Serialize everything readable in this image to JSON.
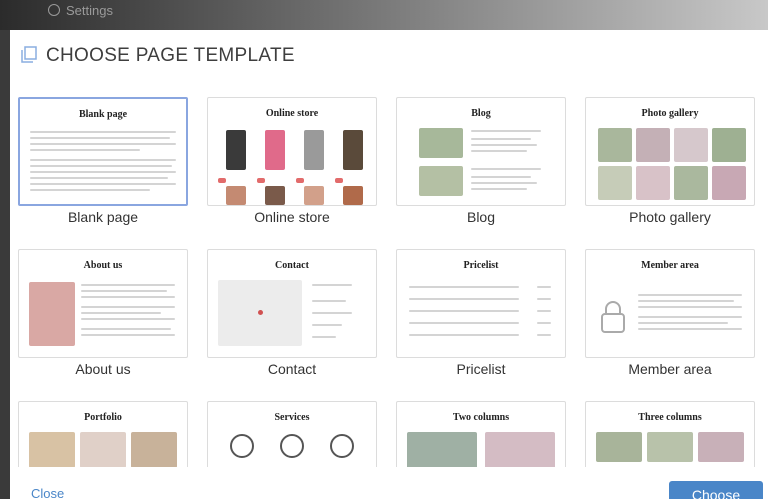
{
  "behind": {
    "label": "Settings",
    "icon": "gear-icon"
  },
  "modal": {
    "title": "CHOOSE PAGE TEMPLATE",
    "title_icon": "pages-icon"
  },
  "templates": [
    {
      "label": "Blank page",
      "thumb_title": "Blank page",
      "selected": true
    },
    {
      "label": "Online store",
      "thumb_title": "Online store"
    },
    {
      "label": "Blog",
      "thumb_title": "Blog"
    },
    {
      "label": "Photo gallery",
      "thumb_title": "Photo gallery"
    },
    {
      "label": "About us",
      "thumb_title": "About us"
    },
    {
      "label": "Contact",
      "thumb_title": "Contact"
    },
    {
      "label": "Pricelist",
      "thumb_title": "Pricelist"
    },
    {
      "label": "Member area",
      "thumb_title": "Member area"
    },
    {
      "label": "",
      "thumb_title": "Portfolio"
    },
    {
      "label": "",
      "thumb_title": "Services"
    },
    {
      "label": "",
      "thumb_title": "Two columns"
    },
    {
      "label": "",
      "thumb_title": "Three columns"
    }
  ],
  "footer": {
    "close_label": "Close",
    "choose_label": "Choose"
  },
  "colors": {
    "accent": "#4a86c8",
    "selected_border": "#8aa6e0"
  }
}
